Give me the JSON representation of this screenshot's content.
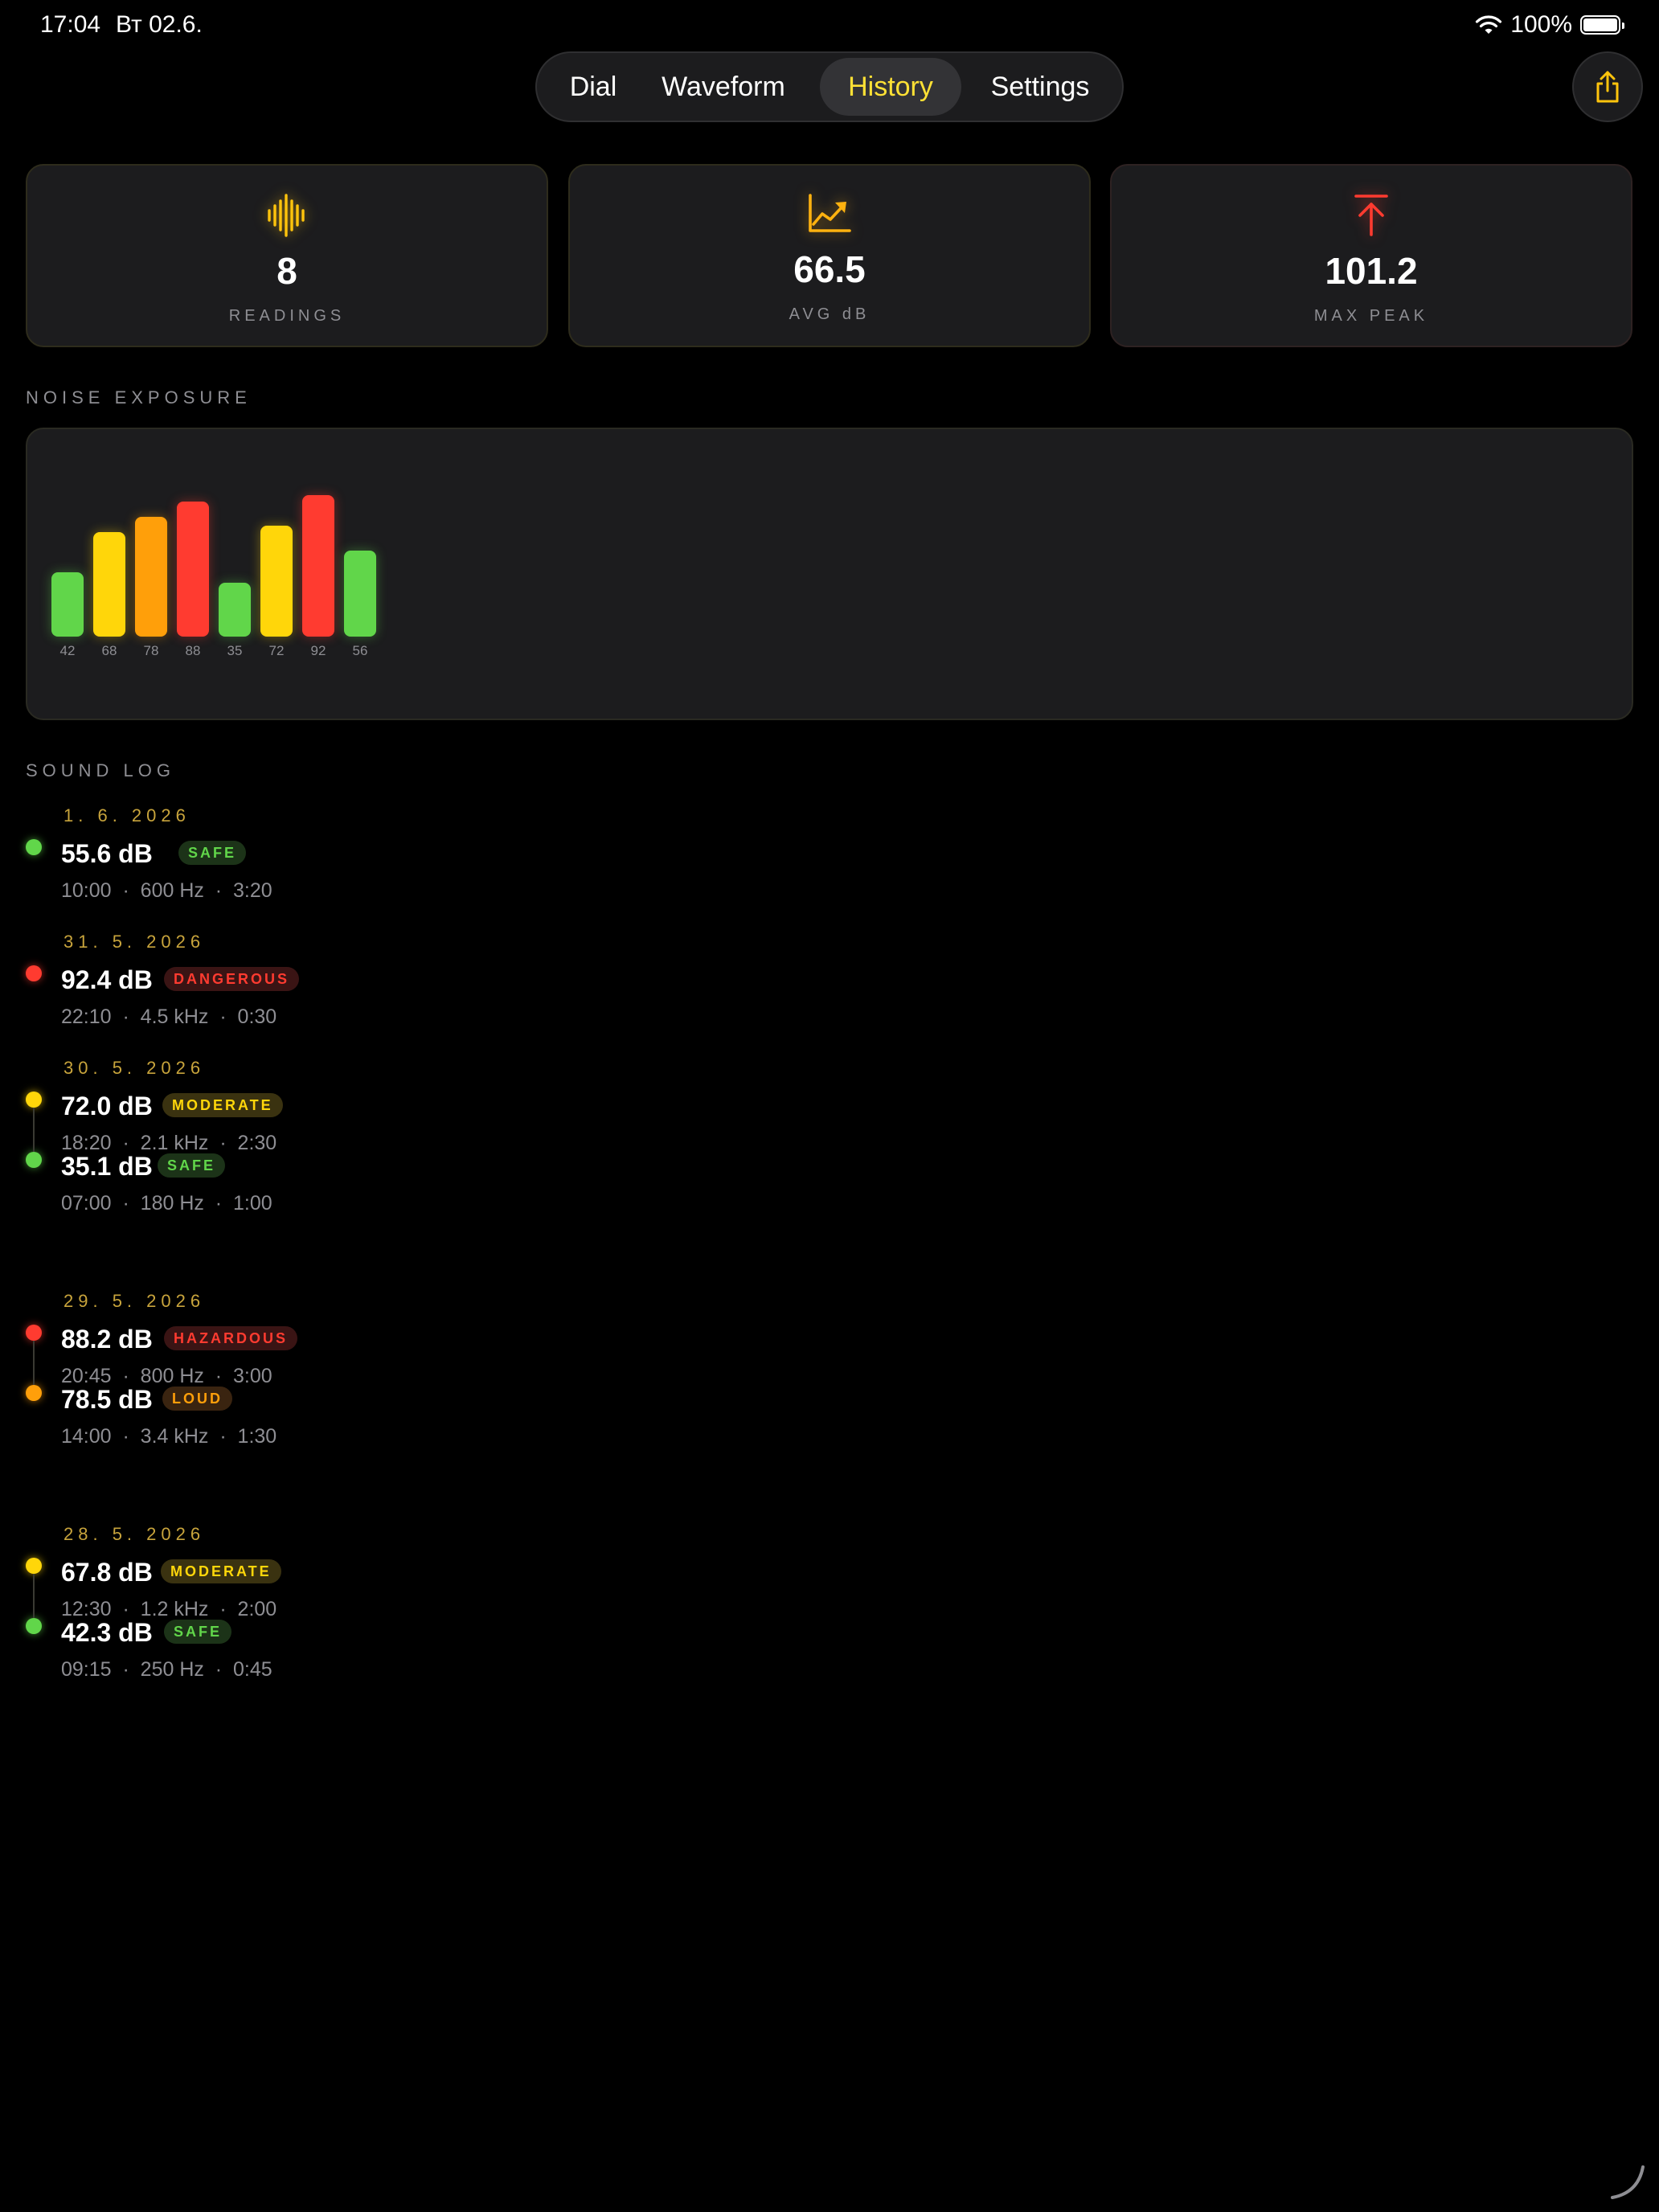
{
  "status_bar": {
    "time": "17:04",
    "date": "Вт 02.6.",
    "battery_percent": "100%"
  },
  "tabs": [
    {
      "label": "Dial",
      "active": false
    },
    {
      "label": "Waveform",
      "active": false
    },
    {
      "label": "History",
      "active": true
    },
    {
      "label": "Settings",
      "active": false
    }
  ],
  "share_icon": "share-icon",
  "stats": [
    {
      "value": "8",
      "label": "READINGS",
      "icon": "waveform-icon",
      "color": "#ffc40c"
    },
    {
      "value": "66.5",
      "label": "AVG dB",
      "icon": "chart-up-icon",
      "color": "#ffb20f"
    },
    {
      "value": "101.2",
      "label": "MAX PEAK",
      "icon": "arrow-up-to-line-icon",
      "color": "#ff3b30"
    }
  ],
  "sections": {
    "noise_exposure": "NOISE EXPOSURE",
    "sound_log": "SOUND LOG"
  },
  "chart_data": {
    "type": "bar",
    "categories": [
      "42",
      "68",
      "78",
      "88",
      "35",
      "72",
      "92",
      "56"
    ],
    "values": [
      42,
      68,
      78,
      88,
      35,
      72,
      92,
      56
    ],
    "colors": [
      "#61d64a",
      "#ffd60a",
      "#ff9f0a",
      "#ff3b30",
      "#61d64a",
      "#ffd60a",
      "#ff3b30",
      "#61d64a"
    ],
    "ylim": [
      0,
      100
    ],
    "grid": false
  },
  "log": [
    {
      "date": "1. 6. 2026",
      "db": "55.6 dB",
      "badge": "SAFE",
      "level": "safe",
      "time": "10:00",
      "freq": "600 Hz",
      "duration": "3:20"
    },
    {
      "date": "31. 5. 2026",
      "db": "92.4 dB",
      "badge": "DANGEROUS",
      "level": "danger",
      "time": "22:10",
      "freq": "4.5 kHz",
      "duration": "0:30"
    },
    {
      "date": "30. 5. 2026",
      "db": "72.0 dB",
      "badge": "MODERATE",
      "level": "moderate",
      "time": "18:20",
      "freq": "2.1 kHz",
      "duration": "2:30"
    },
    {
      "date": "",
      "db": "35.1 dB",
      "badge": "SAFE",
      "level": "safe",
      "time": "07:00",
      "freq": "180 Hz",
      "duration": "1:00"
    },
    {
      "date": "29. 5. 2026",
      "db": "88.2 dB",
      "badge": "HAZARDOUS",
      "level": "danger",
      "time": "20:45",
      "freq": "800 Hz",
      "duration": "3:00"
    },
    {
      "date": "",
      "db": "78.5 dB",
      "badge": "LOUD",
      "level": "loud",
      "time": "14:00",
      "freq": "3.4 kHz",
      "duration": "1:30"
    },
    {
      "date": "28. 5. 2026",
      "db": "67.8 dB",
      "badge": "MODERATE",
      "level": "moderate",
      "time": "12:30",
      "freq": "1.2 kHz",
      "duration": "2:00"
    },
    {
      "date": "",
      "db": "42.3 dB",
      "badge": "SAFE",
      "level": "safe",
      "time": "09:15",
      "freq": "250 Hz",
      "duration": "0:45"
    }
  ],
  "level_colors": {
    "safe": "#61d64a",
    "moderate": "#ffd60a",
    "loud": "#ff9f0a",
    "danger": "#ff3b30"
  }
}
